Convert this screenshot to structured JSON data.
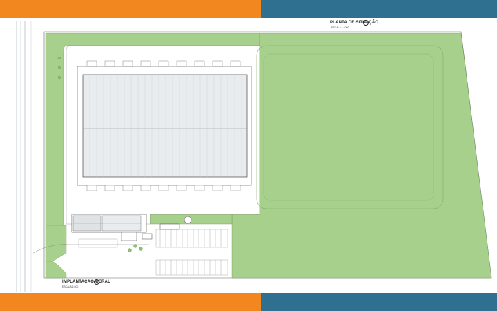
{
  "slide": {
    "band_colors": {
      "orange": "#f2871f",
      "blue": "#2f6f8f",
      "lawn": "#a8d08d",
      "building": "#e9ecee"
    }
  },
  "drawing": {
    "situation_plan_title": "PLANTA DE SITUAÇÃO",
    "situation_plan_scale": "ESCALA 1:1000",
    "general_layout_title": "IMPLANTAÇÃO GERAL",
    "general_layout_scale": "ESCALA 1:500",
    "north_symbol": "N",
    "icons": [
      "north-arrow-icon",
      "north-arrow-icon"
    ]
  }
}
